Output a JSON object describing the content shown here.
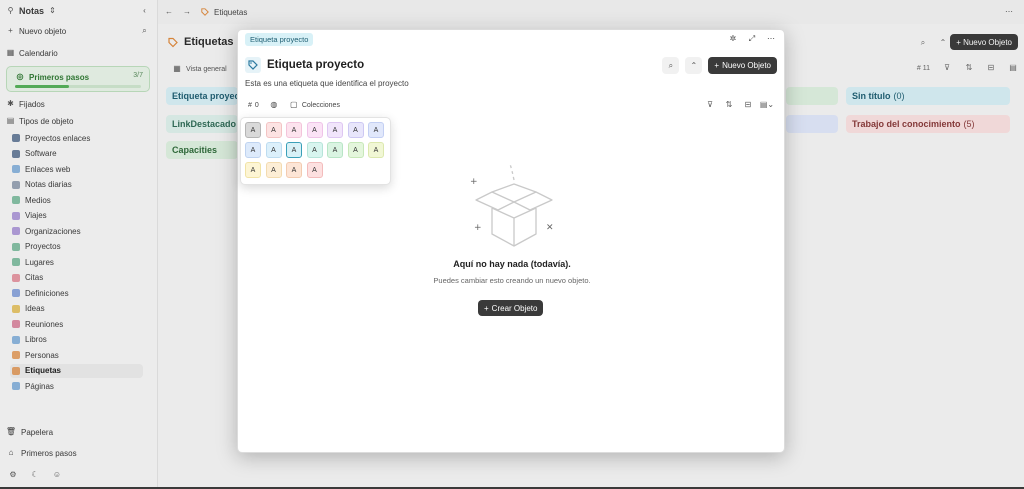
{
  "sidebar": {
    "space_title": "Notas",
    "new_object": "Nuevo objeto",
    "calendar": "Calendario",
    "onboarding": {
      "label": "Primeros pasos",
      "count": "3/7",
      "progress": 0.43
    },
    "pinned": "Fijados",
    "types_header": "Tipos de objeto",
    "types": [
      {
        "label": "Proyectos enlaces",
        "color": "#3d5a80"
      },
      {
        "label": "Software",
        "color": "#3d5a80"
      },
      {
        "label": "Enlaces web",
        "color": "#6aa0d6"
      },
      {
        "label": "Notas diarias",
        "color": "#7a8aa0"
      },
      {
        "label": "Medios",
        "color": "#5fae8a"
      },
      {
        "label": "Viajes",
        "color": "#9b7fd1"
      },
      {
        "label": "Organizaciones",
        "color": "#9b7fd1"
      },
      {
        "label": "Proyectos",
        "color": "#5fae8a"
      },
      {
        "label": "Lugares",
        "color": "#5fae8a"
      },
      {
        "label": "Citas",
        "color": "#e07a8a"
      },
      {
        "label": "Definiciones",
        "color": "#6c8ed6"
      },
      {
        "label": "Ideas",
        "color": "#e0b53c"
      },
      {
        "label": "Reuniones",
        "color": "#d46b8a"
      },
      {
        "label": "Libros",
        "color": "#6aa0d6"
      },
      {
        "label": "Personas",
        "color": "#e08a3c"
      },
      {
        "label": "Etiquetas",
        "color": "#e08a3c",
        "active": true
      },
      {
        "label": "Páginas",
        "color": "#6aa0d6"
      }
    ],
    "bin": "Papelera",
    "first_steps": "Primeros pasos"
  },
  "topbar": {
    "crumb": "Etiquetas"
  },
  "background": {
    "title": "Etiquetas",
    "tab": "Vista general",
    "new_object": "+ Nuevo Objeto",
    "count": "# 11",
    "cards": [
      {
        "label": "Etiqueta proyec",
        "count": "",
        "bg": "#d8f1f7",
        "color": "#1f5f73"
      },
      {
        "label": "LinkDestacado",
        "count": "",
        "bg": "#dff2ec",
        "color": "#2f6b57"
      },
      {
        "label": "Capacities",
        "count": "",
        "bg": "#dff2e1",
        "color": "#2f6b3a"
      },
      {
        "label": "Sin título",
        "count": "(0)",
        "bg": "#d8f1f7",
        "color": "#1f5f73"
      },
      {
        "label": "Trabajo del conocimiento",
        "count": "(5)",
        "bg": "#fbe2e2",
        "color": "#8a3a3a"
      }
    ]
  },
  "modal": {
    "pill": "Etiqueta proyecto",
    "title": "Etiqueta proyecto",
    "description": "Esta es una etiqueta que identifica el proyecto",
    "new_object": "Nuevo Objeto",
    "count": "0",
    "collections": "Colecciones",
    "empty_title": "Aquí no hay nada (todavía).",
    "empty_subtitle": "Puedes cambiar esto creando un nuevo objeto.",
    "create_button": "Crear Objeto"
  },
  "palette": {
    "letter": "A",
    "rows": [
      [
        {
          "bg": "#d9d9d9",
          "border": "#b5b5b5"
        },
        {
          "bg": "#fde3e3",
          "border": "#f3c4c4"
        },
        {
          "bg": "#fde3ee",
          "border": "#f3c4da"
        },
        {
          "bg": "#fbe3f6",
          "border": "#efc4e8"
        },
        {
          "bg": "#f1e5fb",
          "border": "#dec7f2"
        },
        {
          "bg": "#e8e6fb",
          "border": "#cdc8f3"
        },
        {
          "bg": "#e1e8fb",
          "border": "#c3cff3"
        }
      ],
      [
        {
          "bg": "#ddeafb",
          "border": "#bfd3f0"
        },
        {
          "bg": "#dcf0fb",
          "border": "#bddcf0"
        },
        {
          "bg": "#d8f1f7",
          "border": "#3a9fb8"
        },
        {
          "bg": "#d8f5ef",
          "border": "#b6e4d9"
        },
        {
          "bg": "#daf4e2",
          "border": "#b8e5c6"
        },
        {
          "bg": "#e4f6dc",
          "border": "#c7e8b9"
        },
        {
          "bg": "#f1f7d5",
          "border": "#dce8ae"
        }
      ],
      [
        {
          "bg": "#fdf5d4",
          "border": "#f1e3a6"
        },
        {
          "bg": "#fdeed6",
          "border": "#f3dbb0"
        },
        {
          "bg": "#fde5d6",
          "border": "#f3cbb0"
        },
        {
          "bg": "#fde0e0",
          "border": "#f3bcbc"
        }
      ]
    ]
  }
}
